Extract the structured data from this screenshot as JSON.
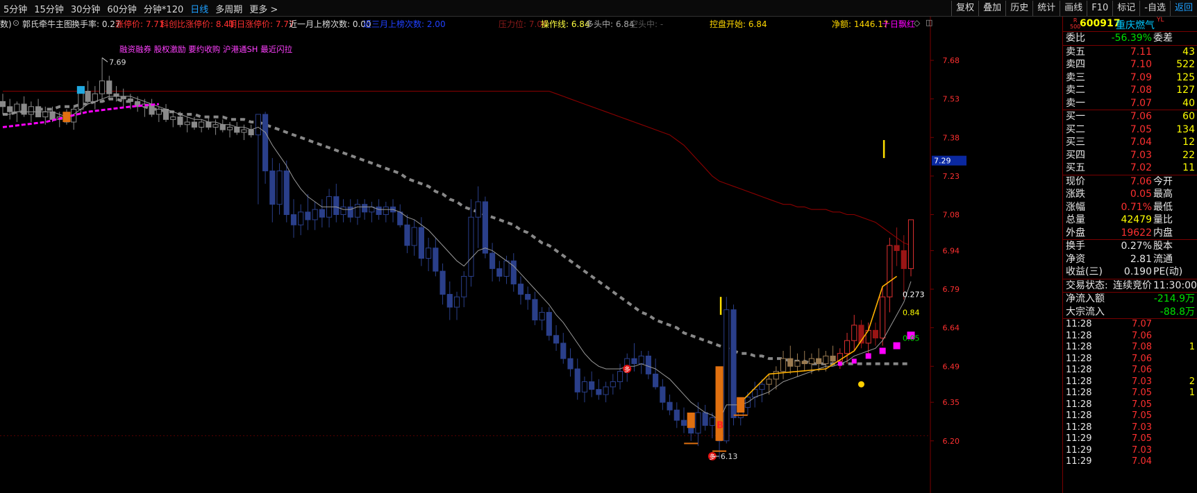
{
  "topbar": {
    "timeframes": [
      "5分钟",
      "15分钟",
      "30分钟",
      "60分钟",
      "分钟*120",
      "日线",
      "多周期",
      "更多 >"
    ],
    "active_timeframe": "日线",
    "tools": [
      "复权",
      "叠加",
      "历史",
      "统计",
      "画线",
      "F10",
      "标记",
      "-自选",
      "返回"
    ]
  },
  "indicator": {
    "prefix": "数)",
    "name": "郭氏牵牛主图",
    "turnover": "换手率: 0.27",
    "limit_up": "涨停价: 7.71",
    "record_limit": "科创比涨停价: 8.41",
    "tomorrow_limit": "明日涨停价: 7.77",
    "month_limit_count": "近一月上榜次数: 0.00",
    "three_month_count": "近三月上榜次数: 2.00",
    "pressure": "压力位: 7.00",
    "operate_line": "操作线: 6.84",
    "bull": "多头中: 6.84",
    "bear": "空头中: -",
    "control_start": "控盘开始: 6.84",
    "net_amount": "净额: 1446.17",
    "ten_day": "十日飘红"
  },
  "chart_data": {
    "type": "candlestick",
    "title": "600917 重庆燃气",
    "y_ticks": [
      7.68,
      7.53,
      7.38,
      7.23,
      7.08,
      6.94,
      6.79,
      6.64,
      6.49,
      6.35,
      6.2
    ],
    "ylim": [
      6.07,
      7.85
    ],
    "current_price_tag": "7.29",
    "annotation": "融资融券 股权激励 要约收购 沪港通SH 最近闪拉",
    "high_label": "7.69",
    "low_label": "6.13",
    "right_labels": [
      "0.273",
      "0.84",
      "0.05"
    ],
    "candles": [
      [
        7.52,
        7.55,
        7.47,
        7.5
      ],
      [
        7.5,
        7.53,
        7.45,
        7.48
      ],
      [
        7.48,
        7.52,
        7.44,
        7.51
      ],
      [
        7.51,
        7.54,
        7.46,
        7.47
      ],
      [
        7.47,
        7.52,
        7.44,
        7.5
      ],
      [
        7.5,
        7.53,
        7.46,
        7.46
      ],
      [
        7.46,
        7.5,
        7.43,
        7.48
      ],
      [
        7.48,
        7.5,
        7.44,
        7.45
      ],
      [
        7.45,
        7.48,
        7.42,
        7.46
      ],
      [
        7.46,
        7.49,
        7.43,
        7.44
      ],
      [
        7.44,
        7.5,
        7.41,
        7.49
      ],
      [
        7.49,
        7.58,
        7.47,
        7.56
      ],
      [
        7.56,
        7.6,
        7.51,
        7.52
      ],
      [
        7.52,
        7.58,
        7.49,
        7.55
      ],
      [
        7.55,
        7.69,
        7.52,
        7.6
      ],
      [
        7.6,
        7.62,
        7.53,
        7.55
      ],
      [
        7.55,
        7.58,
        7.52,
        7.54
      ],
      [
        7.54,
        7.57,
        7.5,
        7.53
      ],
      [
        7.53,
        7.55,
        7.49,
        7.52
      ],
      [
        7.52,
        7.54,
        7.48,
        7.5
      ],
      [
        7.5,
        7.53,
        7.46,
        7.51
      ],
      [
        7.51,
        7.53,
        7.46,
        7.47
      ],
      [
        7.47,
        7.5,
        7.44,
        7.49
      ],
      [
        7.49,
        7.51,
        7.44,
        7.45
      ],
      [
        7.45,
        7.48,
        7.42,
        7.46
      ],
      [
        7.46,
        7.48,
        7.42,
        7.43
      ],
      [
        7.43,
        7.46,
        7.4,
        7.44
      ],
      [
        7.44,
        7.46,
        7.41,
        7.42
      ],
      [
        7.42,
        7.45,
        7.4,
        7.44
      ],
      [
        7.44,
        7.46,
        7.41,
        7.42
      ],
      [
        7.42,
        7.45,
        7.39,
        7.43
      ],
      [
        7.43,
        7.45,
        7.4,
        7.41
      ],
      [
        7.41,
        7.44,
        7.38,
        7.42
      ],
      [
        7.42,
        7.44,
        7.39,
        7.4
      ],
      [
        7.4,
        7.43,
        7.37,
        7.41
      ],
      [
        7.41,
        7.43,
        7.38,
        7.39
      ],
      [
        7.39,
        7.47,
        7.12,
        7.47
      ],
      [
        7.47,
        7.48,
        7.2,
        7.25
      ],
      [
        7.25,
        7.3,
        7.05,
        7.12
      ],
      [
        7.12,
        7.28,
        7.08,
        7.25
      ],
      [
        7.25,
        7.29,
        7.05,
        7.08
      ],
      [
        7.08,
        7.14,
        6.99,
        7.04
      ],
      [
        7.04,
        7.12,
        7.0,
        7.09
      ],
      [
        7.09,
        7.16,
        7.02,
        7.06
      ],
      [
        7.06,
        7.13,
        7.02,
        7.1
      ],
      [
        7.1,
        7.14,
        7.03,
        7.07
      ],
      [
        7.07,
        7.18,
        7.03,
        7.15
      ],
      [
        7.15,
        7.2,
        7.05,
        7.08
      ],
      [
        7.08,
        7.14,
        7.05,
        7.11
      ],
      [
        7.11,
        7.14,
        7.05,
        7.07
      ],
      [
        7.07,
        7.14,
        7.04,
        7.12
      ],
      [
        7.12,
        7.14,
        7.06,
        7.09
      ],
      [
        7.09,
        7.13,
        7.05,
        7.11
      ],
      [
        7.11,
        7.14,
        7.06,
        7.08
      ],
      [
        7.08,
        7.13,
        7.05,
        7.11
      ],
      [
        7.11,
        7.14,
        7.05,
        7.09
      ],
      [
        7.09,
        7.12,
        7.03,
        7.04
      ],
      [
        7.04,
        7.08,
        6.93,
        6.96
      ],
      [
        6.96,
        7.06,
        6.92,
        7.03
      ],
      [
        7.03,
        7.07,
        6.88,
        6.91
      ],
      [
        6.91,
        6.99,
        6.86,
        6.95
      ],
      [
        6.95,
        6.99,
        6.84,
        6.86
      ],
      [
        6.86,
        6.89,
        6.73,
        6.77
      ],
      [
        6.77,
        6.82,
        6.67,
        6.72
      ],
      [
        6.72,
        6.78,
        6.67,
        6.76
      ],
      [
        6.76,
        6.86,
        6.72,
        6.84
      ],
      [
        6.84,
        7.14,
        6.8,
        7.07
      ],
      [
        7.07,
        7.19,
        6.95,
        7.13
      ],
      [
        7.13,
        7.15,
        6.91,
        6.93
      ],
      [
        6.93,
        6.97,
        6.82,
        6.87
      ],
      [
        6.87,
        6.9,
        6.82,
        6.84
      ],
      [
        6.84,
        6.92,
        6.81,
        6.9
      ],
      [
        6.9,
        6.93,
        6.78,
        6.81
      ],
      [
        6.81,
        6.84,
        6.73,
        6.77
      ],
      [
        6.77,
        6.8,
        6.71,
        6.75
      ],
      [
        6.75,
        6.78,
        6.65,
        6.67
      ],
      [
        6.67,
        6.72,
        6.63,
        6.7
      ],
      [
        6.7,
        6.72,
        6.59,
        6.61
      ],
      [
        6.61,
        6.65,
        6.55,
        6.58
      ],
      [
        6.58,
        6.62,
        6.5,
        6.52
      ],
      [
        6.52,
        6.56,
        6.45,
        6.48
      ],
      [
        6.48,
        6.52,
        6.36,
        6.39
      ],
      [
        6.39,
        6.45,
        6.35,
        6.43
      ],
      [
        6.43,
        6.47,
        6.37,
        6.4
      ],
      [
        6.4,
        6.44,
        6.36,
        6.38
      ],
      [
        6.38,
        6.43,
        6.35,
        6.41
      ],
      [
        6.41,
        6.46,
        6.38,
        6.43
      ],
      [
        6.43,
        6.5,
        6.4,
        6.47
      ],
      [
        6.47,
        6.54,
        6.43,
        6.52
      ],
      [
        6.52,
        6.58,
        6.47,
        6.5
      ],
      [
        6.5,
        6.55,
        6.46,
        6.53
      ],
      [
        6.53,
        6.55,
        6.44,
        6.46
      ],
      [
        6.46,
        6.52,
        6.4,
        6.41
      ],
      [
        6.41,
        6.44,
        6.32,
        6.35
      ],
      [
        6.35,
        6.38,
        6.3,
        6.32
      ],
      [
        6.32,
        6.35,
        6.25,
        6.28
      ],
      [
        6.28,
        6.33,
        6.23,
        6.26
      ],
      [
        6.26,
        6.31,
        6.2,
        6.23
      ],
      [
        6.23,
        6.35,
        6.18,
        6.31
      ],
      [
        6.31,
        6.34,
        6.24,
        6.26
      ],
      [
        6.26,
        6.31,
        6.21,
        6.29
      ],
      [
        6.29,
        6.32,
        6.13,
        6.2
      ],
      [
        6.2,
        6.76,
        6.19,
        6.71
      ],
      [
        6.71,
        6.73,
        6.26,
        6.29
      ],
      [
        6.29,
        6.36,
        6.26,
        6.33
      ],
      [
        6.33,
        6.39,
        6.3,
        6.37
      ],
      [
        6.37,
        6.43,
        6.33,
        6.4
      ],
      [
        6.4,
        6.44,
        6.35,
        6.42
      ],
      [
        6.42,
        6.46,
        6.38,
        6.44
      ],
      [
        6.44,
        6.49,
        6.4,
        6.47
      ],
      [
        6.47,
        6.55,
        6.44,
        6.52
      ],
      [
        6.52,
        6.57,
        6.46,
        6.49
      ],
      [
        6.49,
        6.54,
        6.45,
        6.51
      ],
      [
        6.51,
        6.55,
        6.47,
        6.5
      ],
      [
        6.5,
        6.54,
        6.46,
        6.52
      ],
      [
        6.52,
        6.56,
        6.47,
        6.5
      ],
      [
        6.5,
        6.55,
        6.47,
        6.53
      ],
      [
        6.53,
        6.57,
        6.49,
        6.51
      ],
      [
        6.51,
        6.56,
        6.48,
        6.54
      ],
      [
        6.54,
        6.62,
        6.5,
        6.59
      ],
      [
        6.59,
        6.69,
        6.55,
        6.65
      ],
      [
        6.65,
        6.67,
        6.56,
        6.58
      ],
      [
        6.58,
        6.66,
        6.54,
        6.63
      ],
      [
        6.63,
        6.66,
        6.57,
        6.6
      ],
      [
        6.6,
        6.8,
        6.57,
        6.76
      ],
      [
        6.76,
        6.99,
        6.7,
        6.96
      ],
      [
        6.96,
        7.03,
        6.88,
        6.94
      ],
      [
        6.94,
        7.0,
        6.75,
        6.87
      ],
      [
        6.87,
        7.03,
        6.84,
        7.06
      ]
    ],
    "ma_short": [
      7.47,
      7.47,
      7.48,
      7.48,
      7.48,
      7.48,
      7.48,
      7.48,
      7.47,
      7.46,
      7.47,
      7.49,
      7.51,
      7.52,
      7.53,
      7.54,
      7.54,
      7.54,
      7.54,
      7.53,
      7.52,
      7.51,
      7.5,
      7.49,
      7.48,
      7.47,
      7.46,
      7.45,
      7.45,
      7.44,
      7.44,
      7.43,
      7.43,
      7.42,
      7.42,
      7.41,
      7.42,
      7.4,
      7.35,
      7.31,
      7.27,
      7.22,
      7.18,
      7.15,
      7.13,
      7.11,
      7.11,
      7.11,
      7.1,
      7.1,
      7.11,
      7.11,
      7.11,
      7.1,
      7.1,
      7.1,
      7.09,
      7.07,
      7.06,
      7.04,
      7.02,
      6.99,
      6.96,
      6.93,
      6.9,
      6.88,
      6.91,
      6.94,
      6.95,
      6.94,
      6.92,
      6.9,
      6.88,
      6.85,
      6.82,
      6.79,
      6.76,
      6.73,
      6.69,
      6.66,
      6.62,
      6.58,
      6.54,
      6.51,
      6.49,
      6.48,
      6.48,
      6.48,
      6.49,
      6.49,
      6.5,
      6.49,
      6.48,
      6.46,
      6.44,
      6.41,
      6.38,
      6.35,
      6.33,
      6.31,
      6.3,
      6.28,
      6.34,
      6.34,
      6.34,
      6.35,
      6.37,
      6.38,
      6.39,
      6.41,
      6.43,
      6.44,
      6.45,
      6.46,
      6.47,
      6.48,
      6.49,
      6.49,
      6.5,
      6.51,
      6.53,
      6.54,
      6.55,
      6.56,
      6.59,
      6.64,
      6.69,
      6.74,
      6.82
    ],
    "ma_long": [
      7.56,
      7.56,
      7.56,
      7.56,
      7.56,
      7.56,
      7.56,
      7.56,
      7.56,
      7.56,
      7.56,
      7.56,
      7.56,
      7.56,
      7.56,
      7.56,
      7.56,
      7.56,
      7.56,
      7.56,
      7.56,
      7.56,
      7.56,
      7.56,
      7.56,
      7.56,
      7.56,
      7.56,
      7.56,
      7.56,
      7.56,
      7.56,
      7.56,
      7.56,
      7.56,
      7.56,
      7.56,
      7.56,
      7.56,
      7.56,
      7.56,
      7.56,
      7.56,
      7.56,
      7.56,
      7.56,
      7.56,
      7.56,
      7.56,
      7.56,
      7.56,
      7.56,
      7.56,
      7.56,
      7.56,
      7.56,
      7.56,
      7.56,
      7.56,
      7.56,
      7.56,
      7.56,
      7.56,
      7.56,
      7.56,
      7.56,
      7.56,
      7.56,
      7.56,
      7.56,
      7.56,
      7.56,
      7.56,
      7.56,
      7.56,
      7.56,
      7.56,
      7.56,
      7.55,
      7.54,
      7.53,
      7.52,
      7.51,
      7.5,
      7.49,
      7.48,
      7.47,
      7.46,
      7.45,
      7.44,
      7.43,
      7.42,
      7.41,
      7.4,
      7.39,
      7.37,
      7.35,
      7.32,
      7.29,
      7.26,
      7.23,
      7.21,
      7.2,
      7.19,
      7.18,
      7.17,
      7.16,
      7.15,
      7.14,
      7.13,
      7.12,
      7.12,
      7.11,
      7.11,
      7.1,
      7.1,
      7.1,
      7.09,
      7.09,
      7.08,
      7.08,
      7.07,
      7.06,
      7.05,
      7.03,
      7.01,
      6.99,
      6.97,
      6.96
    ],
    "step_line": [
      7.47,
      7.47,
      7.48,
      7.48,
      7.48,
      7.49,
      7.49,
      7.49,
      7.5,
      7.5,
      7.5,
      7.51,
      7.51,
      7.52,
      7.52,
      7.53,
      7.53,
      7.52,
      7.52,
      7.51,
      7.5,
      7.49,
      7.49,
      7.48,
      7.48,
      7.47,
      7.47,
      7.47,
      7.46,
      7.46,
      7.46,
      7.46,
      7.45,
      7.45,
      7.45,
      7.44,
      7.44,
      7.43,
      7.42,
      7.41,
      7.4,
      7.39,
      7.38,
      7.37,
      7.36,
      7.35,
      7.34,
      7.33,
      7.32,
      7.31,
      7.3,
      7.29,
      7.28,
      7.27,
      7.26,
      7.25,
      7.24,
      7.22,
      7.21,
      7.2,
      7.19,
      7.17,
      7.16,
      7.14,
      7.13,
      7.11,
      7.1,
      7.09,
      7.08,
      7.07,
      7.06,
      7.05,
      7.04,
      7.02,
      7.01,
      6.99,
      6.97,
      6.96,
      6.94,
      6.92,
      6.9,
      6.88,
      6.86,
      6.84,
      6.82,
      6.8,
      6.78,
      6.76,
      6.74,
      6.72,
      6.7,
      6.69,
      6.67,
      6.66,
      6.65,
      6.64,
      6.62,
      6.61,
      6.6,
      6.59,
      6.58,
      6.57,
      6.56,
      6.55,
      6.54,
      6.54,
      6.53,
      6.53,
      6.52,
      6.52,
      6.52,
      6.51,
      6.51,
      6.51,
      6.5,
      6.5,
      6.5,
      6.5,
      6.5,
      6.5,
      6.5,
      6.5,
      6.5,
      6.5,
      6.5,
      6.5,
      6.5,
      6.5,
      6.5
    ],
    "signals": [
      {
        "index": 9,
        "kind": "orange",
        "low": 7.44,
        "high": 7.48
      },
      {
        "index": 11,
        "kind": "cyan",
        "low": 7.55,
        "high": 7.58
      },
      {
        "index": 97,
        "kind": "orange",
        "low": 6.25,
        "high": 6.31
      },
      {
        "index": 101,
        "kind": "orange-big",
        "low": 6.2,
        "high": 6.49
      },
      {
        "index": 104,
        "kind": "orange",
        "low": 6.31,
        "high": 6.37
      }
    ],
    "yellow_spikes": [
      {
        "index": 101,
        "high": 6.76
      },
      {
        "index": 124,
        "high": 7.37
      }
    ],
    "markers": [
      {
        "index": 88,
        "price": 6.48,
        "label": "多"
      },
      {
        "index": 100,
        "price": 6.14,
        "label": "多"
      },
      {
        "index": 101,
        "price": 6.25,
        "label": "B"
      }
    ],
    "yellow_dot": {
      "index": 121,
      "price": 6.42
    }
  },
  "panel": {
    "code": "600917",
    "name": "重庆燃气",
    "name_suffix": "YL",
    "badge_top": "R",
    "badge_bottom": "500",
    "weibi_label": "委比",
    "weibi_value": "-56.39%",
    "weicha_label": "委差",
    "sell": [
      {
        "label": "卖五",
        "price": "7.11",
        "vol": "43"
      },
      {
        "label": "卖四",
        "price": "7.10",
        "vol": "522"
      },
      {
        "label": "卖三",
        "price": "7.09",
        "vol": "125"
      },
      {
        "label": "卖二",
        "price": "7.08",
        "vol": "127"
      },
      {
        "label": "卖一",
        "price": "7.07",
        "vol": "40"
      }
    ],
    "buy": [
      {
        "label": "买一",
        "price": "7.06",
        "vol": "60"
      },
      {
        "label": "买二",
        "price": "7.05",
        "vol": "134"
      },
      {
        "label": "买三",
        "price": "7.04",
        "vol": "12"
      },
      {
        "label": "买四",
        "price": "7.03",
        "vol": "22"
      },
      {
        "label": "买五",
        "price": "7.02",
        "vol": "11"
      }
    ],
    "stats": [
      {
        "l1": "现价",
        "v1": "7.06",
        "c1": "red",
        "l2": "今开"
      },
      {
        "l1": "涨跌",
        "v1": "0.05",
        "c1": "red",
        "l2": "最高"
      },
      {
        "l1": "涨幅",
        "v1": "0.71%",
        "c1": "red",
        "l2": "最低"
      },
      {
        "l1": "总量",
        "v1": "42479",
        "c1": "yellow",
        "l2": "量比"
      },
      {
        "l1": "外盘",
        "v1": "19622",
        "c1": "red",
        "l2": "内盘"
      }
    ],
    "stats2": [
      {
        "l1": "换手",
        "v1": "0.27%",
        "l2": "股本"
      },
      {
        "l1": "净资",
        "v1": "2.81",
        "l2": "流通"
      },
      {
        "l1": "收益(三)",
        "v1": "0.190",
        "l2": "PE(动)"
      }
    ],
    "trade_status_label": "交易状态:",
    "trade_status_value": "连续竞价",
    "trade_time": "11:30:00",
    "net_inflow_label": "净流入额",
    "net_inflow_value": "-214.9万",
    "block_inflow_label": "大宗流入",
    "block_inflow_value": "-88.8万",
    "ticks": [
      {
        "time": "11:28",
        "price": "7.07",
        "vol": ""
      },
      {
        "time": "11:28",
        "price": "7.06",
        "vol": ""
      },
      {
        "time": "11:28",
        "price": "7.08",
        "vol": "1"
      },
      {
        "time": "11:28",
        "price": "7.06",
        "vol": ""
      },
      {
        "time": "11:28",
        "price": "7.06",
        "vol": ""
      },
      {
        "time": "11:28",
        "price": "7.03",
        "vol": "2"
      },
      {
        "time": "11:28",
        "price": "7.05",
        "vol": "1"
      },
      {
        "time": "11:28",
        "price": "7.05",
        "vol": ""
      },
      {
        "time": "11:28",
        "price": "7.05",
        "vol": ""
      },
      {
        "time": "11:28",
        "price": "7.03",
        "vol": ""
      },
      {
        "time": "11:29",
        "price": "7.05",
        "vol": ""
      },
      {
        "time": "11:29",
        "price": "7.03",
        "vol": ""
      },
      {
        "time": "11:29",
        "price": "7.04",
        "vol": ""
      }
    ]
  }
}
